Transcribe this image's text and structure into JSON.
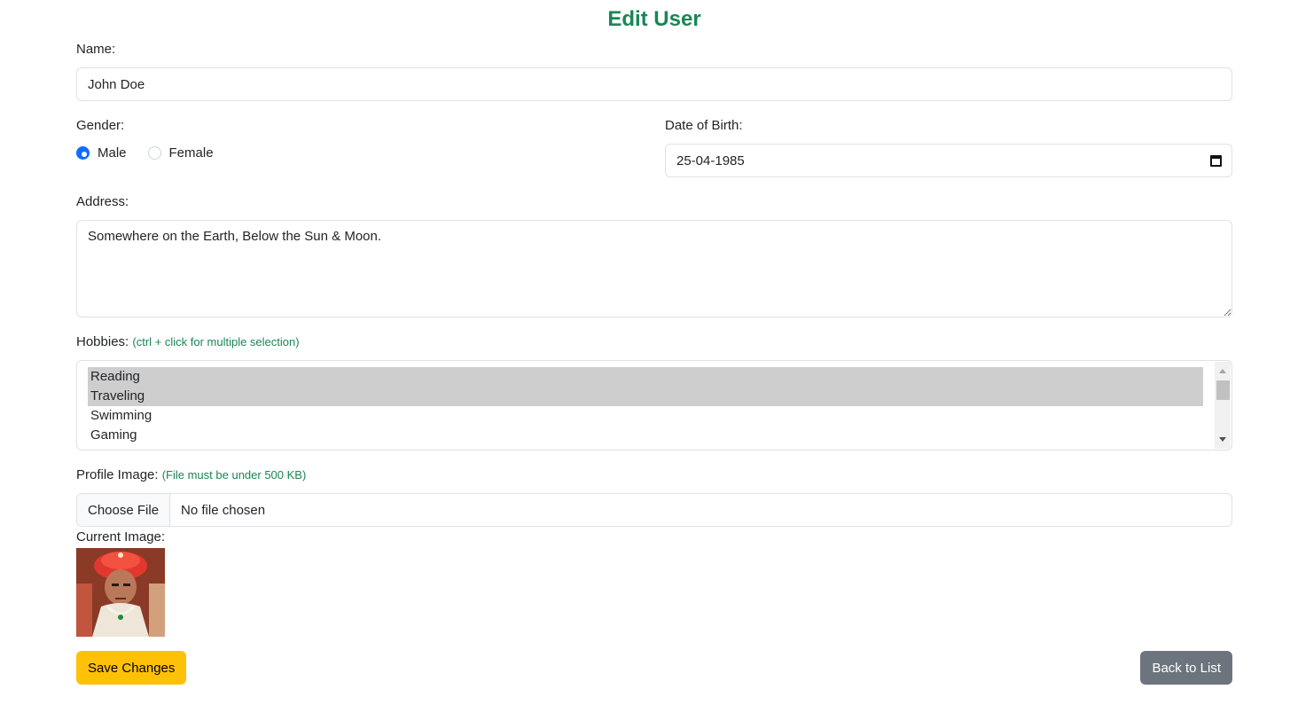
{
  "page_title": "Edit User",
  "name": {
    "label": "Name:",
    "value": "John Doe"
  },
  "gender": {
    "label": "Gender:",
    "options": [
      {
        "label": "Male",
        "checked": true
      },
      {
        "label": "Female",
        "checked": false
      }
    ]
  },
  "dob": {
    "label": "Date of Birth:",
    "value": "25-04-1985"
  },
  "address": {
    "label": "Address:",
    "value": "Somewhere on the Earth, Below the Sun & Moon."
  },
  "hobbies": {
    "label": "Hobbies:",
    "hint": "(ctrl + click for multiple selection)",
    "options": [
      {
        "label": "Reading",
        "selected": true
      },
      {
        "label": "Traveling",
        "selected": true
      },
      {
        "label": "Swimming",
        "selected": false
      },
      {
        "label": "Gaming",
        "selected": false
      }
    ]
  },
  "profile_image": {
    "label": "Profile Image:",
    "hint": "(File must be under 500 KB)",
    "button_label": "Choose File",
    "status": "No file chosen"
  },
  "current_image": {
    "label": "Current Image:"
  },
  "actions": {
    "save_label": "Save Changes",
    "back_label": "Back to List"
  },
  "colors": {
    "title": "#198754",
    "radio_checked": "#0d6efd",
    "save": "#ffc107",
    "back": "#6c757d"
  }
}
